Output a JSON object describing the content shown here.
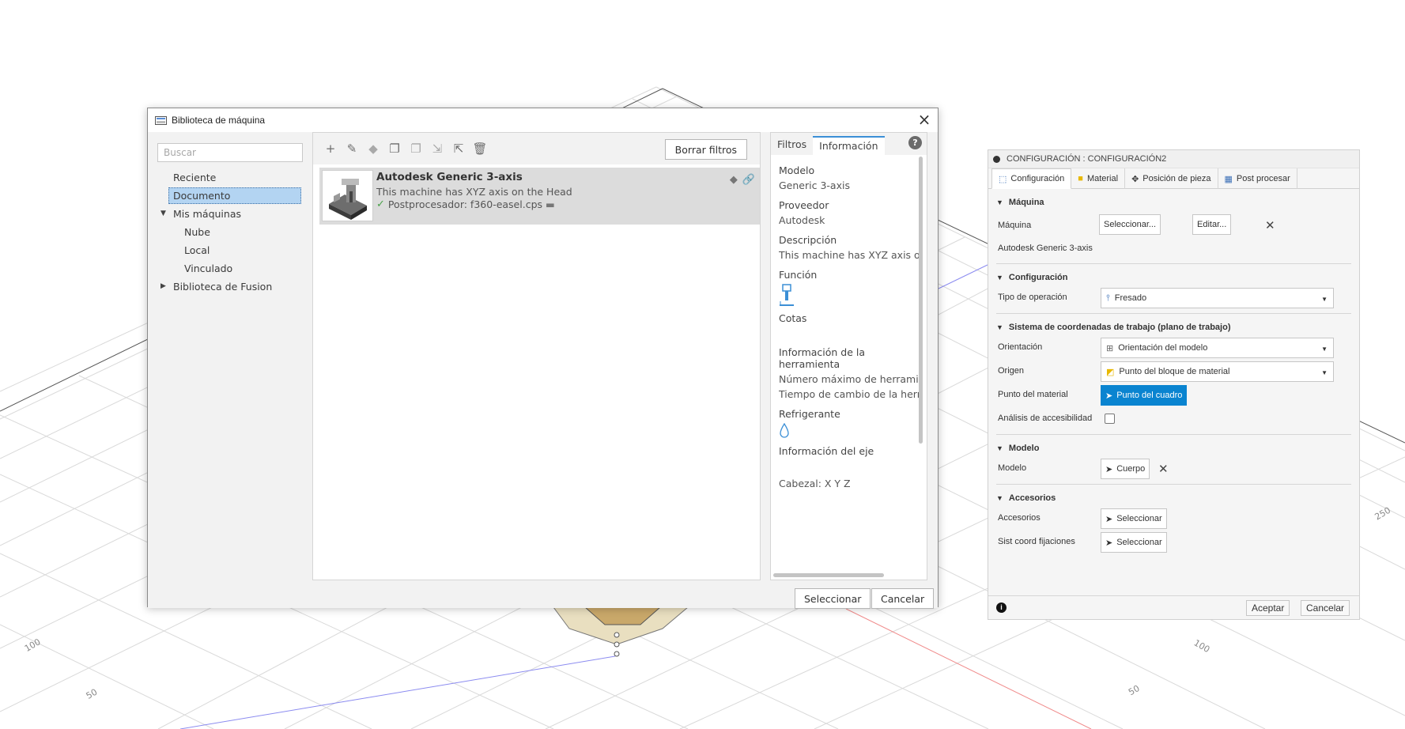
{
  "dialog": {
    "title": "Biblioteca de máquina",
    "search_placeholder": "Buscar",
    "tree": [
      "Reciente",
      "Documento",
      "Mis máquinas",
      "Nube",
      "Local",
      "Vinculado",
      "Biblioteca de Fusion"
    ],
    "clear_filters": "Borrar filtros",
    "machine": {
      "name": "Autodesk Generic 3-axis",
      "description": "This machine has XYZ axis on the Head",
      "post": "Postprocesador: f360-easel.cps"
    },
    "tabs": [
      "Filtros",
      "Información"
    ],
    "info": {
      "model_label": "Modelo",
      "model_value": "Generic 3-axis",
      "vendor_label": "Proveedor",
      "vendor_value": "Autodesk",
      "desc_label": "Descripción",
      "desc_value": "This machine has XYZ axis on the Head",
      "function_label": "Función",
      "dims_label": "Cotas",
      "tool_info_label": "Información de la herramienta",
      "max_tools": "Número máximo de herramientas",
      "tool_change": "Tiempo de cambio de la herramienta",
      "coolant_label": "Refrigerante",
      "axis_info_label": "Información del eje",
      "head_axes": "Cabezal: X Y Z"
    },
    "select_btn": "Seleccionar",
    "cancel_btn": "Cancelar"
  },
  "config": {
    "title": "CONFIGURACIÓN : CONFIGURACIÓN2",
    "tabs": [
      "Configuración",
      "Material",
      "Posición de pieza",
      "Post procesar"
    ],
    "machine_section": "Máquina",
    "machine_label": "Máquina",
    "select_machine_btn": "Seleccionar...",
    "edit_btn": "Editar...",
    "machine_name": "Autodesk Generic 3-axis",
    "setup_section": "Configuración",
    "op_type_label": "Tipo de operación",
    "op_type_value": "Fresado",
    "wcs_section": "Sistema de coordenadas de trabajo (plano de trabajo)",
    "orientation_label": "Orientación",
    "orientation_value": "Orientación del modelo",
    "origin_label": "Origen",
    "origin_value": "Punto del bloque de material",
    "stock_point_label": "Punto del material",
    "stock_point_value": "Punto del cuadro",
    "access_label": "Análisis de accesibilidad",
    "model_section": "Modelo",
    "model_label": "Modelo",
    "model_value": "Cuerpo",
    "fixtures_section": "Accesorios",
    "fixtures_label": "Accesorios",
    "fixtures_value": "Seleccionar",
    "fixture_wcs_label": "Sist coord fijaciones",
    "fixture_wcs_value": "Seleccionar",
    "ok_btn": "Aceptar",
    "cancel_btn": "Cancelar"
  },
  "viewport": {
    "ticks": [
      "100",
      "50",
      "100",
      "50",
      "250"
    ]
  }
}
